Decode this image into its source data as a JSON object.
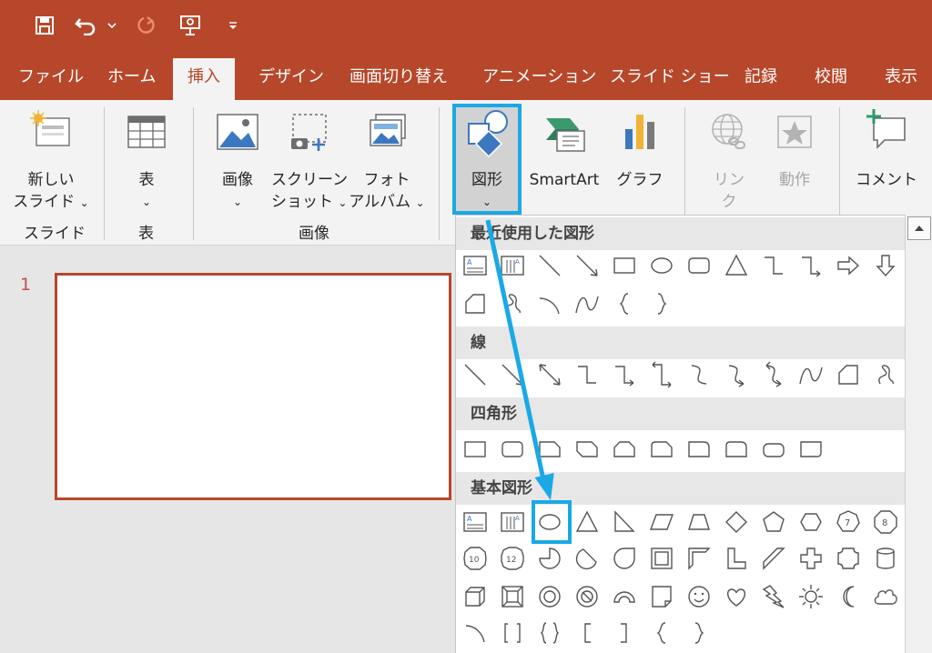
{
  "tabs": [
    "ファイル",
    "ホーム",
    "挿入",
    "デザイン",
    "画面切り替え",
    "アニメーション",
    "スライド ショー",
    "記録",
    "校閲",
    "表示"
  ],
  "ribbon": {
    "new_slide": [
      "新しい",
      "スライド"
    ],
    "table": "表",
    "image": "画像",
    "screenshot": [
      "スクリーン",
      "ショット"
    ],
    "photo_album": [
      "フォト",
      "アルバム"
    ],
    "shapes": "図形",
    "smartart": "SmartArt",
    "graph": "グラフ",
    "link": [
      "リン",
      "ク"
    ],
    "action": "動作",
    "comment": "コメント",
    "groups": {
      "slide": "スライド",
      "table": "表",
      "image": "画像"
    }
  },
  "slide_number": "1",
  "shapes_menu": {
    "sections": [
      "最近使用した図形",
      "線",
      "四角形",
      "基本図形"
    ]
  },
  "colors": {
    "accent": "#b7472a",
    "highlight": "#1aa9e5"
  }
}
